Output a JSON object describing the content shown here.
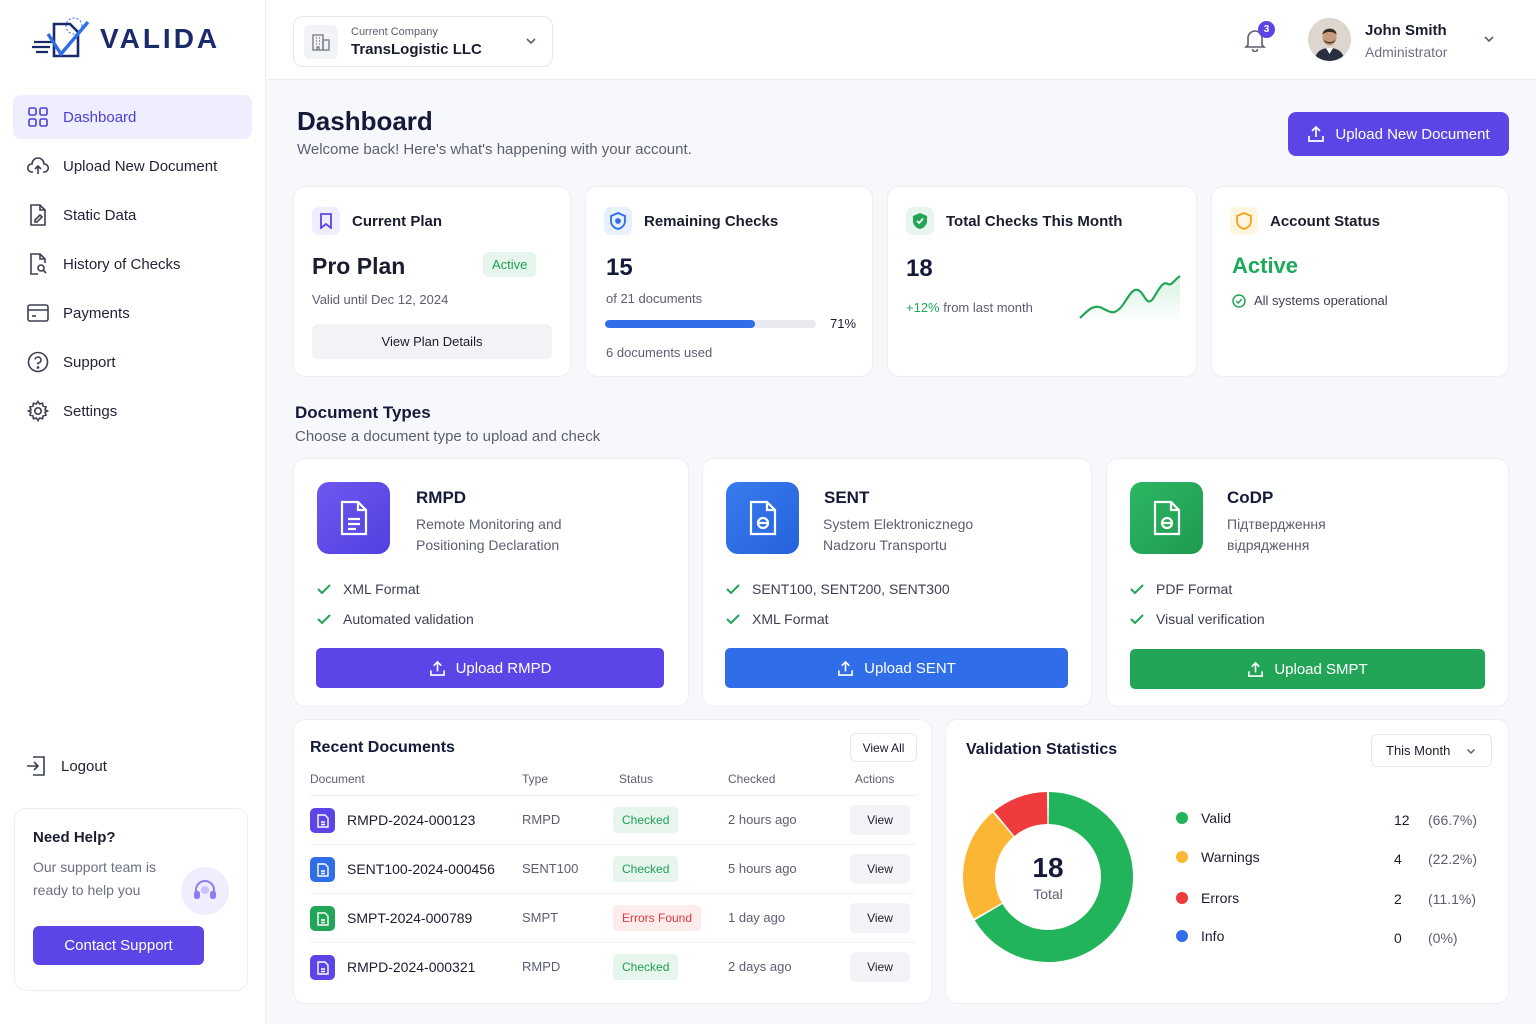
{
  "brand": {
    "name": "VALIDA"
  },
  "sidebar": {
    "items": [
      {
        "label": "Dashboard",
        "icon": "grid-icon",
        "active": true
      },
      {
        "label": "Upload New Document",
        "icon": "cloud-upload-icon"
      },
      {
        "label": "Static Data",
        "icon": "document-edit-icon"
      },
      {
        "label": "History of Checks",
        "icon": "document-search-icon"
      },
      {
        "label": "Payments",
        "icon": "card-icon"
      },
      {
        "label": "Support",
        "icon": "help-circle-icon"
      },
      {
        "label": "Settings",
        "icon": "gear-icon"
      }
    ],
    "logout": "Logout",
    "help": {
      "title": "Need Help?",
      "text": "Our support team is ready to help you",
      "button": "Contact Support"
    }
  },
  "topbar": {
    "company_label": "Current Company",
    "company_name": "TransLogistic LLC",
    "notifications": "3",
    "user_name": "John Smith",
    "user_role": "Administrator"
  },
  "header": {
    "title": "Dashboard",
    "subtitle": "Welcome back! Here's what's happening with your account.",
    "upload_button": "Upload New Document"
  },
  "cards": {
    "plan": {
      "title": "Current Plan",
      "name": "Pro Plan",
      "badge": "Active",
      "valid": "Valid until Dec 12, 2024",
      "button": "View Plan Details"
    },
    "remaining": {
      "title": "Remaining Checks",
      "value": "15",
      "of": "of 21 documents",
      "percent_label": "71%",
      "progress": 0.71,
      "used": "6 documents used"
    },
    "total": {
      "title": "Total Checks This Month",
      "value": "18",
      "change": "+12%",
      "change_text": "from last month"
    },
    "account": {
      "title": "Account Status",
      "value": "Active",
      "note": "All systems operational"
    }
  },
  "doc_types": {
    "title": "Document Types",
    "subtitle": "Choose a document type to upload and check",
    "items": [
      {
        "name": "RMPD",
        "desc": "Remote Monitoring and Positioning Declaration",
        "features": [
          "XML Format",
          "Automated validation"
        ],
        "button": "Upload RMPD",
        "color": "#5b45e6"
      },
      {
        "name": "SENT",
        "desc": "System Elektronicznego Nadzoru Transportu",
        "features": [
          "SENT100, SENT200, SENT300",
          "XML Format"
        ],
        "button": "Upload SENT",
        "color": "#2f6ee8"
      },
      {
        "name": "CoDP",
        "desc": "Підтвердження відрядження",
        "features": [
          "PDF Format",
          "Visual verification"
        ],
        "button": "Upload SMPT",
        "color": "#22a557"
      }
    ]
  },
  "recent": {
    "title": "Recent Documents",
    "view_all": "View All",
    "columns": [
      "Document",
      "Type",
      "Status",
      "Checked",
      "Actions"
    ],
    "rows": [
      {
        "name": "RMPD-2024-000123",
        "type": "RMPD",
        "status": "Checked",
        "time": "2 hours ago",
        "action": "View"
      },
      {
        "name": "SENT100-2024-000456",
        "type": "SENT100",
        "status": "Checked",
        "time": "5 hours ago",
        "action": "View"
      },
      {
        "name": "SMPT-2024-000789",
        "type": "SMPT",
        "status": "Errors Found",
        "time": "1 day ago",
        "action": "View"
      },
      {
        "name": "RMPD-2024-000321",
        "type": "RMPD",
        "status": "Checked",
        "time": "2 days ago",
        "action": "View"
      }
    ]
  },
  "stats": {
    "title": "Validation Statistics",
    "period": "This Month",
    "total": "18",
    "total_label": "Total",
    "legend": [
      {
        "label": "Valid",
        "value": "12",
        "pct": "(66.7%)",
        "color": "#22b45a"
      },
      {
        "label": "Warnings",
        "value": "4",
        "pct": "(22.2%)",
        "color": "#fbb733"
      },
      {
        "label": "Errors",
        "value": "2",
        "pct": "(11.1%)",
        "color": "#ef3b3b"
      },
      {
        "label": "Info",
        "value": "0",
        "pct": "(0%)",
        "color": "#2f6ee8"
      }
    ]
  }
}
